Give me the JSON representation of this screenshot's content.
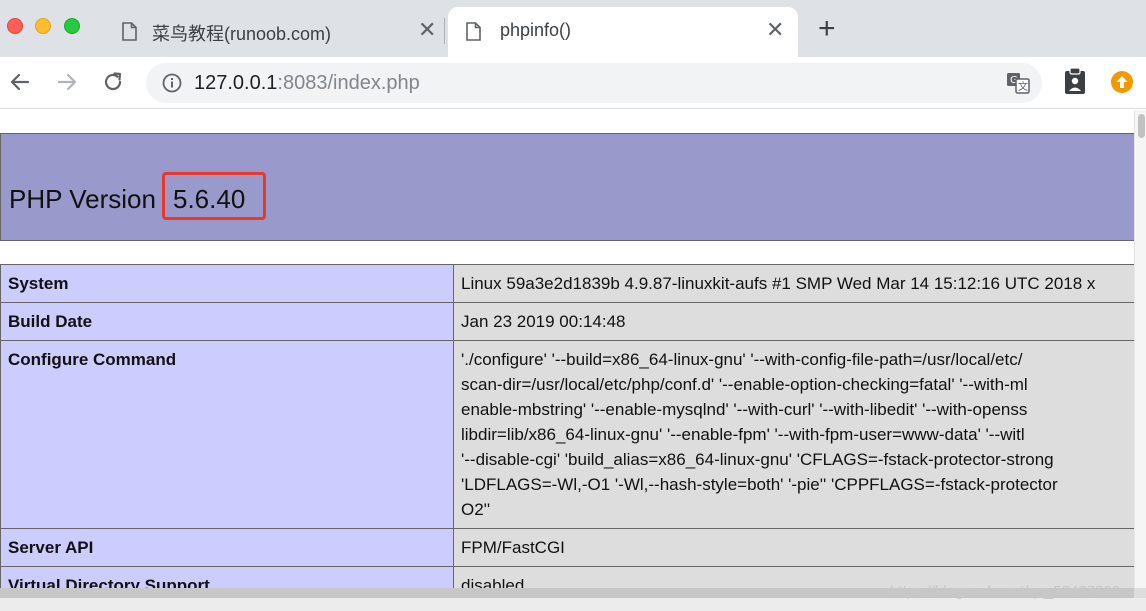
{
  "browser": {
    "tabs": [
      {
        "title": "菜鸟教程(runoob.com)",
        "active": false
      },
      {
        "title": "phpinfo()",
        "active": true
      }
    ],
    "new_tab_label": "+",
    "close_label": "✕"
  },
  "address_bar": {
    "host": "127.0.0.1",
    "path": ":8083/index.php"
  },
  "page": {
    "heading_prefix": "PHP Version",
    "version": "5.6.40",
    "highlight_color": "#e8372b",
    "header_bg": "#9999cc",
    "rows": [
      {
        "key": "System",
        "value": "Linux 59a3e2d1839b 4.9.87-linuxkit-aufs #1 SMP Wed Mar 14 15:12:16 UTC 2018 x"
      },
      {
        "key": "Build Date",
        "value": "Jan 23 2019 00:14:48"
      },
      {
        "key": "Configure Command",
        "lines": [
          "'./configure' '--build=x86_64-linux-gnu' '--with-config-file-path=/usr/local/etc/",
          "scan-dir=/usr/local/etc/php/conf.d' '--enable-option-checking=fatal' '--with-ml",
          "enable-mbstring' '--enable-mysqlnd' '--with-curl' '--with-libedit' '--with-openss",
          "libdir=lib/x86_64-linux-gnu' '--enable-fpm' '--with-fpm-user=www-data' '--witl",
          "'--disable-cgi' 'build_alias=x86_64-linux-gnu' 'CFLAGS=-fstack-protector-strong",
          "'LDFLAGS=-Wl,-O1 '-Wl,--hash-style=both' '-pie'' 'CPPFLAGS=-fstack-protector",
          "O2''"
        ]
      },
      {
        "key": "Server API",
        "value": "FPM/FastCGI"
      },
      {
        "key": "Virtual Directory Support",
        "value": "disabled"
      }
    ]
  },
  "watermark": "https://blog.csdn.net/qq_58437833"
}
